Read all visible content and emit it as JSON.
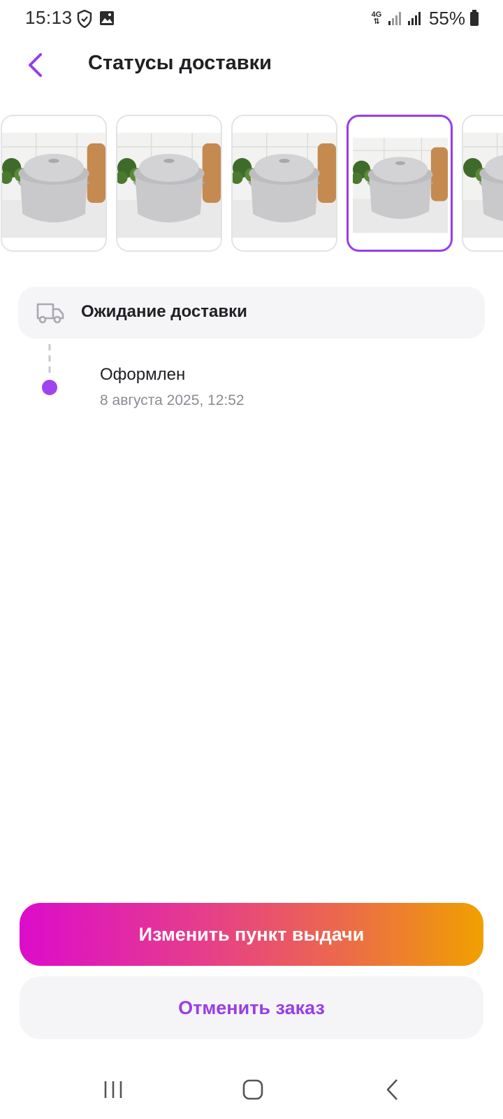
{
  "status_bar": {
    "time": "15:13",
    "network": "4G",
    "battery": "55%",
    "icons": [
      "shield-icon",
      "gallery-icon",
      "signal-icon",
      "battery-icon"
    ]
  },
  "header": {
    "title": "Статусы доставки",
    "back_icon": "chevron-left-icon"
  },
  "thumbnails": {
    "selected_index": 3,
    "items": [
      {
        "icon": "cooking-pot-image"
      },
      {
        "icon": "cooking-pot-image"
      },
      {
        "icon": "cooking-pot-image"
      },
      {
        "icon": "cooking-pot-image"
      },
      {
        "icon": "cooking-pot-image"
      }
    ]
  },
  "status_card": {
    "icon": "truck-icon",
    "title": "Ожидание доставки"
  },
  "timeline": {
    "events": [
      {
        "title": "Оформлен",
        "date": "8 августа 2025, 12:52"
      }
    ]
  },
  "actions": {
    "primary_label": "Изменить пункт выдачи",
    "secondary_label": "Отменить заказ"
  },
  "colors": {
    "accent": "#9a3de6",
    "gradient_start": "#dc0ccb",
    "gradient_end": "#f0a000",
    "card_bg": "#f5f5f7"
  },
  "nav_bar": {
    "icons": [
      "recent-apps-icon",
      "home-icon",
      "back-icon"
    ]
  }
}
